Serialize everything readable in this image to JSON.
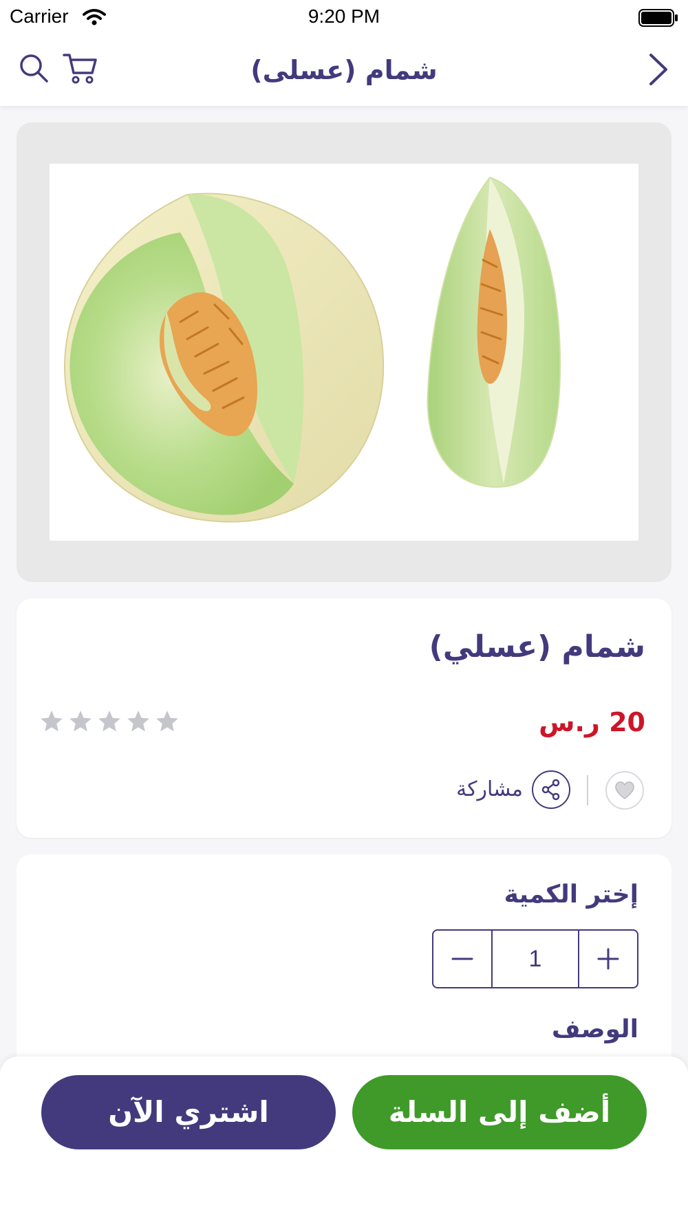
{
  "status_bar": {
    "carrier": "Carrier",
    "time": "9:20 PM"
  },
  "nav": {
    "title": "شمام (عسلى)",
    "icons": [
      "search-icon",
      "cart-icon",
      "chevron-right-icon"
    ]
  },
  "product": {
    "image_description_icon": "melon-image",
    "title": "شمام (عسلي)",
    "price": "20 ر.س",
    "rating": 0,
    "rating_max": 5,
    "share_label": "مشاركة"
  },
  "quantity": {
    "label": "إختر الكمية",
    "value": "1"
  },
  "description": {
    "label": "الوصف"
  },
  "actions": {
    "buy_now_label": "اشتري الآن",
    "add_to_cart_label": "أضف إلى السلة"
  },
  "colors": {
    "brand_purple": "#433a7d",
    "price_red": "#cc1628",
    "add_green": "#3f9a29",
    "star_grey": "#c4c6cc"
  }
}
